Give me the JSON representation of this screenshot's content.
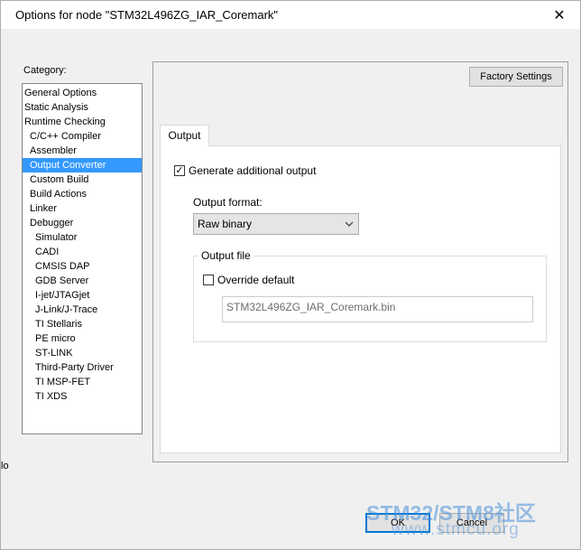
{
  "window": {
    "title": "Options for node \"STM32L496ZG_IAR_Coremark\"",
    "close_glyph": "✕"
  },
  "category": {
    "label": "Category:",
    "items": [
      {
        "label": "General Options",
        "level": 0
      },
      {
        "label": "Static Analysis",
        "level": 0
      },
      {
        "label": "Runtime Checking",
        "level": 0
      },
      {
        "label": "C/C++ Compiler",
        "level": 1
      },
      {
        "label": "Assembler",
        "level": 1
      },
      {
        "label": "Output Converter",
        "level": 1,
        "selected": true
      },
      {
        "label": "Custom Build",
        "level": 1
      },
      {
        "label": "Build Actions",
        "level": 1
      },
      {
        "label": "Linker",
        "level": 1
      },
      {
        "label": "Debugger",
        "level": 1
      },
      {
        "label": "Simulator",
        "level": 2
      },
      {
        "label": "CADI",
        "level": 2
      },
      {
        "label": "CMSIS DAP",
        "level": 2
      },
      {
        "label": "GDB Server",
        "level": 2
      },
      {
        "label": "I-jet/JTAGjet",
        "level": 2
      },
      {
        "label": "J-Link/J-Trace",
        "level": 2
      },
      {
        "label": "TI Stellaris",
        "level": 2
      },
      {
        "label": "PE micro",
        "level": 2
      },
      {
        "label": "ST-LINK",
        "level": 2
      },
      {
        "label": "Third-Party Driver",
        "level": 2
      },
      {
        "label": "TI MSP-FET",
        "level": 2
      },
      {
        "label": "TI XDS",
        "level": 2
      }
    ]
  },
  "factory_settings_label": "Factory Settings",
  "tab": {
    "label": "Output"
  },
  "generate": {
    "label": "Generate additional output",
    "checked": true,
    "check_glyph": "✓"
  },
  "output_format": {
    "label": "Output format:",
    "value": "Raw binary"
  },
  "output_file": {
    "legend": "Output file",
    "override_label": "Override default",
    "override_checked": false,
    "value": "STM32L496ZG_IAR_Coremark.bin"
  },
  "buttons": {
    "ok": "OK",
    "cancel": "Cancel"
  },
  "clipped_text": "lo",
  "watermark": {
    "main": "STM32/STM8社区",
    "url": "www.stmcu.org"
  },
  "colors": {
    "selection": "#3399ff",
    "ok_border": "#0078d7",
    "watermark": "#4a90d9"
  }
}
